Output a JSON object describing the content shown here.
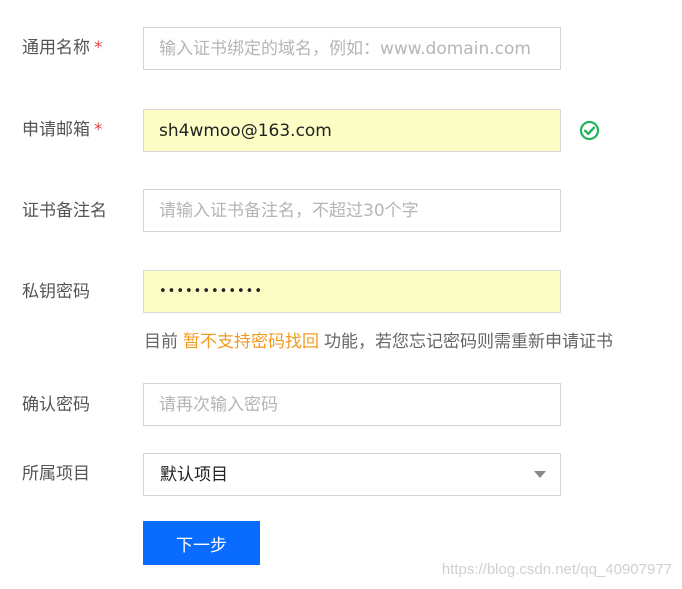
{
  "form": {
    "common_name": {
      "label": "通用名称",
      "required_mark": "*",
      "placeholder": "输入证书绑定的域名，例如：www.domain.com",
      "value": ""
    },
    "email": {
      "label": "申请邮箱",
      "required_mark": "*",
      "value": "sh4wmoo@163.com",
      "status_icon": "check-circle-icon",
      "status_color": "#21b35a"
    },
    "cert_remark": {
      "label": "证书备注名",
      "placeholder": "请输入证书备注名，不超过30个字",
      "value": ""
    },
    "private_key_password": {
      "label": "私钥密码",
      "value": "••••••••••••"
    },
    "hint": {
      "prefix": "目前",
      "warning": "暂不支持密码找回",
      "suffix": "功能，若您忘记密码则需重新申请证书"
    },
    "confirm_password": {
      "label": "确认密码",
      "placeholder": "请再次输入密码",
      "value": ""
    },
    "project": {
      "label": "所属项目",
      "selected": "默认项目"
    },
    "next_button": {
      "label": "下一步"
    }
  },
  "watermark": "https://blog.csdn.net/qq_40907977",
  "colors": {
    "primary_button": "#0a6cff",
    "required": "#e54545",
    "warning_text": "#f39a1f",
    "autofill_bg": "#fdfec6"
  }
}
